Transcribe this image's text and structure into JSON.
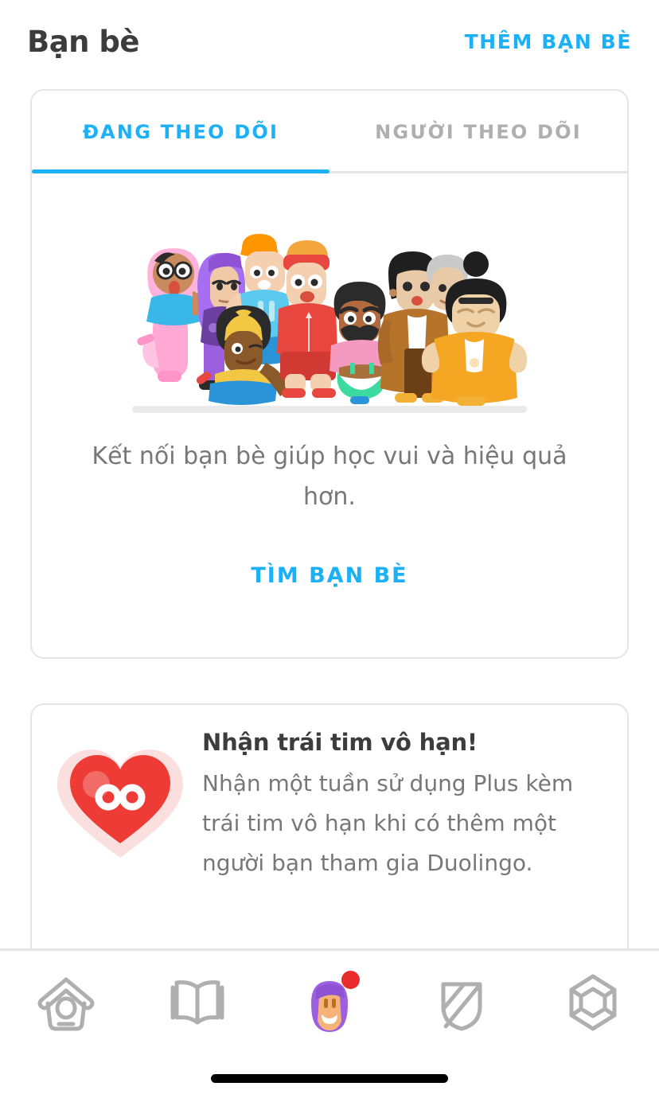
{
  "header": {
    "title": "Bạn bè",
    "add_friend_label": "THÊM BẠN BÈ"
  },
  "tabs": [
    {
      "label": "ĐANG THEO DÕI",
      "active": true
    },
    {
      "label": "NGƯỜI THEO DÕI",
      "active": false
    }
  ],
  "empty_state": {
    "illustration_name": "duolingo-characters-group",
    "message": "Kết nối bạn bè giúp học vui và hiệu quả hơn.",
    "cta_label": "TÌM BẠN BÈ"
  },
  "promo": {
    "icon_name": "infinite-hearts-icon",
    "title": "Nhận trái tim vô hạn!",
    "description": "Nhận một tuần sử dụng Plus kèm trái tim vô hạn khi có thêm một người bạn tham gia Duolingo."
  },
  "bottom_nav": [
    {
      "name": "birdhouse-icon",
      "label": "Home",
      "active": false,
      "badge": false
    },
    {
      "name": "book-icon",
      "label": "Learn",
      "active": false,
      "badge": false
    },
    {
      "name": "profile-avatar-icon",
      "label": "Profile",
      "active": true,
      "badge": true
    },
    {
      "name": "shield-icon",
      "label": "Leagues",
      "active": false,
      "badge": false
    },
    {
      "name": "gem-icon",
      "label": "Shop",
      "active": false,
      "badge": false
    }
  ],
  "colors": {
    "accent_blue": "#1cb0f6",
    "title_gray": "#3c3c3c",
    "body_gray": "#777777",
    "border_gray": "#e5e5e5",
    "inactive_gray": "#afafaf",
    "heart_red": "#ee3b36",
    "heart_glow": "#fbdede",
    "badge_red": "#ea2b2b"
  }
}
